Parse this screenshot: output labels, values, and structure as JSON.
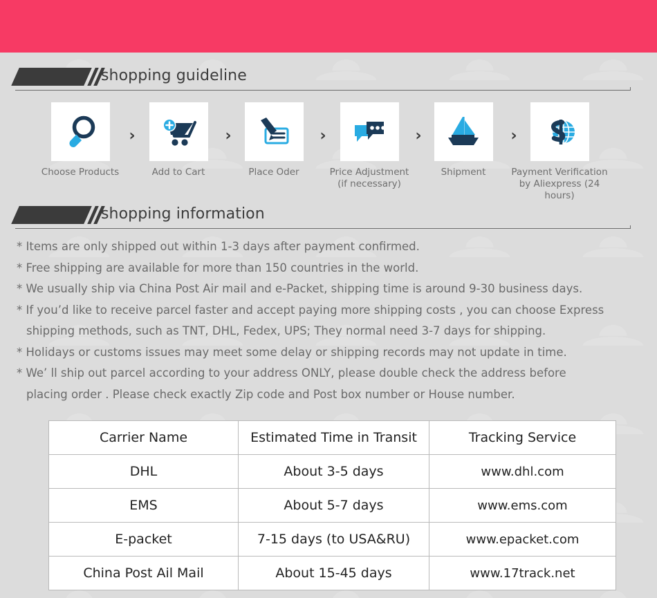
{
  "banner": {
    "color": "#f73a64"
  },
  "sections": {
    "guideline": {
      "title": "shopping guideline"
    },
    "information": {
      "title": "shopping information"
    }
  },
  "steps": [
    {
      "icon": "magnifier-icon",
      "label": "Choose Products"
    },
    {
      "icon": "shopping-cart-plus-icon",
      "label": "Add to Cart"
    },
    {
      "icon": "pen-check-icon",
      "label": "Place Oder"
    },
    {
      "icon": "chat-bubbles-icon",
      "label": "Price Adjustment\n(if necessary)"
    },
    {
      "icon": "sailboat-icon",
      "label": "Shipment"
    },
    {
      "icon": "dollar-globe-icon",
      "label": "Payment Verification\nby  Aliexpress (24 hours)"
    }
  ],
  "step_separator": "›",
  "info_lines": [
    {
      "text": "* Items are only shipped out within 1-3 days after payment confirmed.",
      "cont": false
    },
    {
      "text": "* Free shipping are available for more than 150 countries in the world.",
      "cont": false
    },
    {
      "text": "* We usually ship via China Post Air mail and e-Packet, shipping time is around 9-30 business days.",
      "cont": false
    },
    {
      "text": "* If you’d like to receive parcel faster and accept paying more shipping costs , you can choose Express",
      "cont": false
    },
    {
      "text": "shipping methods, such as TNT, DHL, Fedex, UPS; They normal need 3-7 days for shipping.",
      "cont": true
    },
    {
      "text": "* Holidays or customs issues may meet some delay or shipping records may not update in time.",
      "cont": false
    },
    {
      "text": "* We’ ll ship out parcel according to your address ONLY, please double check the address before",
      "cont": false
    },
    {
      "text": "placing order . Please check exactly Zip code and Post box number or House number.",
      "cont": true
    }
  ],
  "carrier_table": {
    "headers": [
      "Carrier Name",
      "Estimated Time in Transit",
      "Tracking Service"
    ],
    "rows": [
      [
        "DHL",
        "About 3-5 days",
        "www.dhl.com"
      ],
      [
        "EMS",
        "About 5-7 days",
        "www.ems.com"
      ],
      [
        "E-packet",
        "7-15 days (to USA&RU)",
        "www.epacket.com"
      ],
      [
        "China Post Ail Mail",
        "About 15-45 days",
        "www.17track.net"
      ]
    ]
  },
  "colors": {
    "background": "#dcdcdc",
    "banner_pink": "#f73a64",
    "icon_navy": "#1b3a57",
    "icon_cyan": "#29abe2",
    "heading_dark": "#3b3b3b",
    "body_text": "#6a6a6a"
  }
}
